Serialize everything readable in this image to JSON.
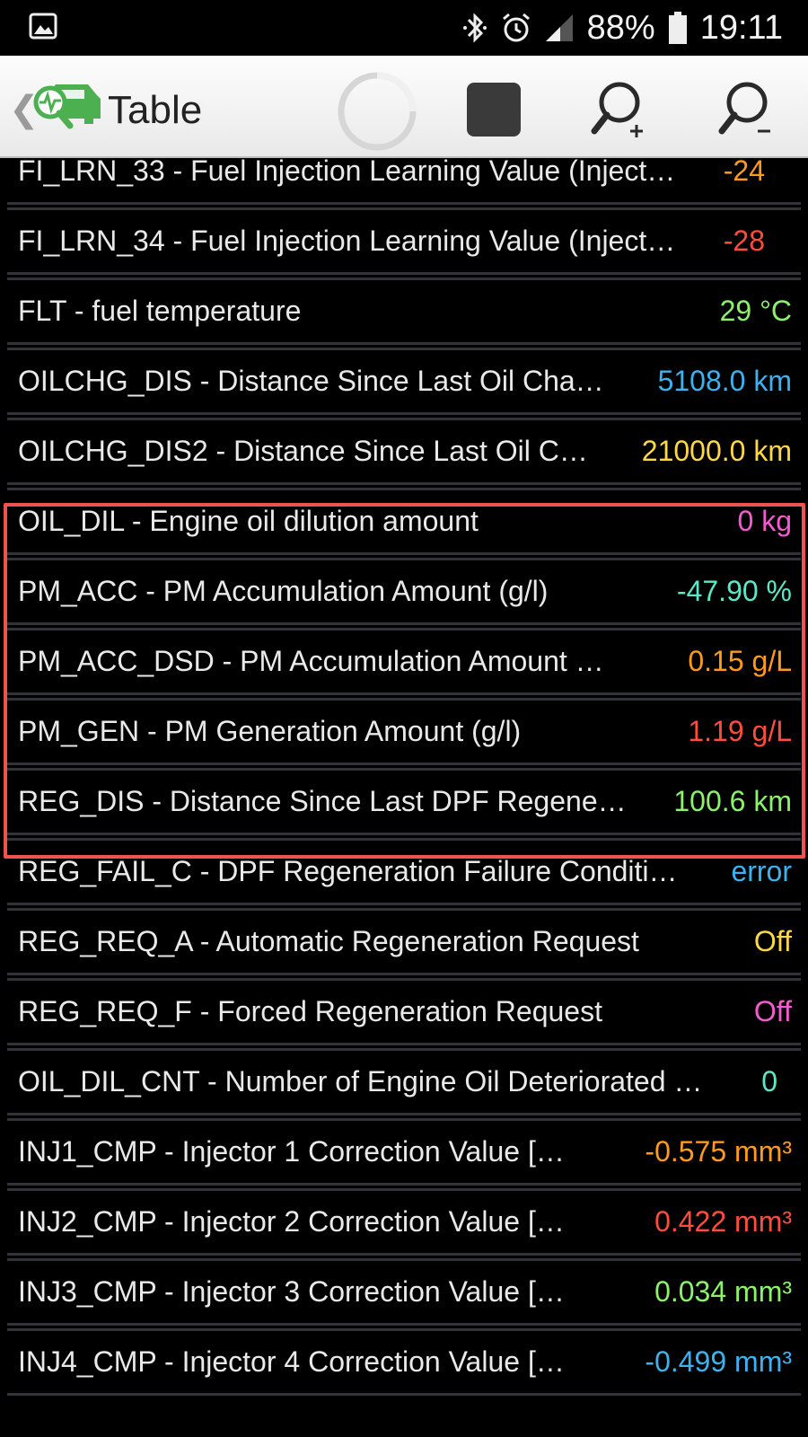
{
  "status_bar": {
    "battery": "88%",
    "time": "19:11"
  },
  "app_bar": {
    "title": "Table"
  },
  "rows": [
    {
      "label": "FI_LRN_33 - Fuel Injection Learning Value (Inject…",
      "value": "-24",
      "color": "#ff9a1f"
    },
    {
      "label": "FI_LRN_34 - Fuel Injection Learning Value (Inject…",
      "value": "-28",
      "color": "#ff4d3d"
    },
    {
      "label": "FLT - fuel temperature",
      "value": "29 °C",
      "color": "#8cf26b"
    },
    {
      "label": "OILCHG_DIS - Distance Since Last Oil Cha…",
      "value": "5108.0 km",
      "color": "#3db2f0"
    },
    {
      "label": "OILCHG_DIS2 - Distance Since Last Oil C…",
      "value": "21000.0 km",
      "color": "#ffd84a"
    },
    {
      "label": "OIL_DIL - Engine oil dilution amount",
      "value": "0 kg",
      "color": "#f25ccf"
    },
    {
      "label": "PM_ACC - PM Accumulation Amount (g/l)",
      "value": "-47.90 %",
      "color": "#5ce8c8"
    },
    {
      "label": "PM_ACC_DSD - PM Accumulation Amount …",
      "value": "0.15 g/L",
      "color": "#ff9a1f"
    },
    {
      "label": "PM_GEN - PM Generation Amount (g/l)",
      "value": "1.19 g/L",
      "color": "#ff4d3d"
    },
    {
      "label": "REG_DIS - Distance Since Last DPF Regene…",
      "value": "100.6 km",
      "color": "#8cf26b"
    },
    {
      "label": "REG_FAIL_C - DPF Regeneration Failure Conditi…",
      "value": "error",
      "color": "#3db2f0"
    },
    {
      "label": "REG_REQ_A - Automatic Regeneration Request",
      "value": "Off",
      "color": "#ffd84a"
    },
    {
      "label": "REG_REQ_F - Forced Regeneration Request",
      "value": "Off",
      "color": "#f25ccf"
    },
    {
      "label": "OIL_DIL_CNT - Number of Engine Oil Deteriorated …",
      "value": "0",
      "color": "#5ce8c8"
    },
    {
      "label": "INJ1_CMP - Injector 1 Correction Value […",
      "value": "-0.575 mm³",
      "color": "#ff9a1f"
    },
    {
      "label": "INJ2_CMP - Injector 2 Correction Value […",
      "value": "0.422 mm³",
      "color": "#ff4d3d"
    },
    {
      "label": "INJ3_CMP - Injector 3 Correction Value […",
      "value": "0.034 mm³",
      "color": "#8cf26b"
    },
    {
      "label": "INJ4_CMP - Injector 4 Correction Value […",
      "value": "-0.499 mm³",
      "color": "#3db2f0"
    }
  ]
}
